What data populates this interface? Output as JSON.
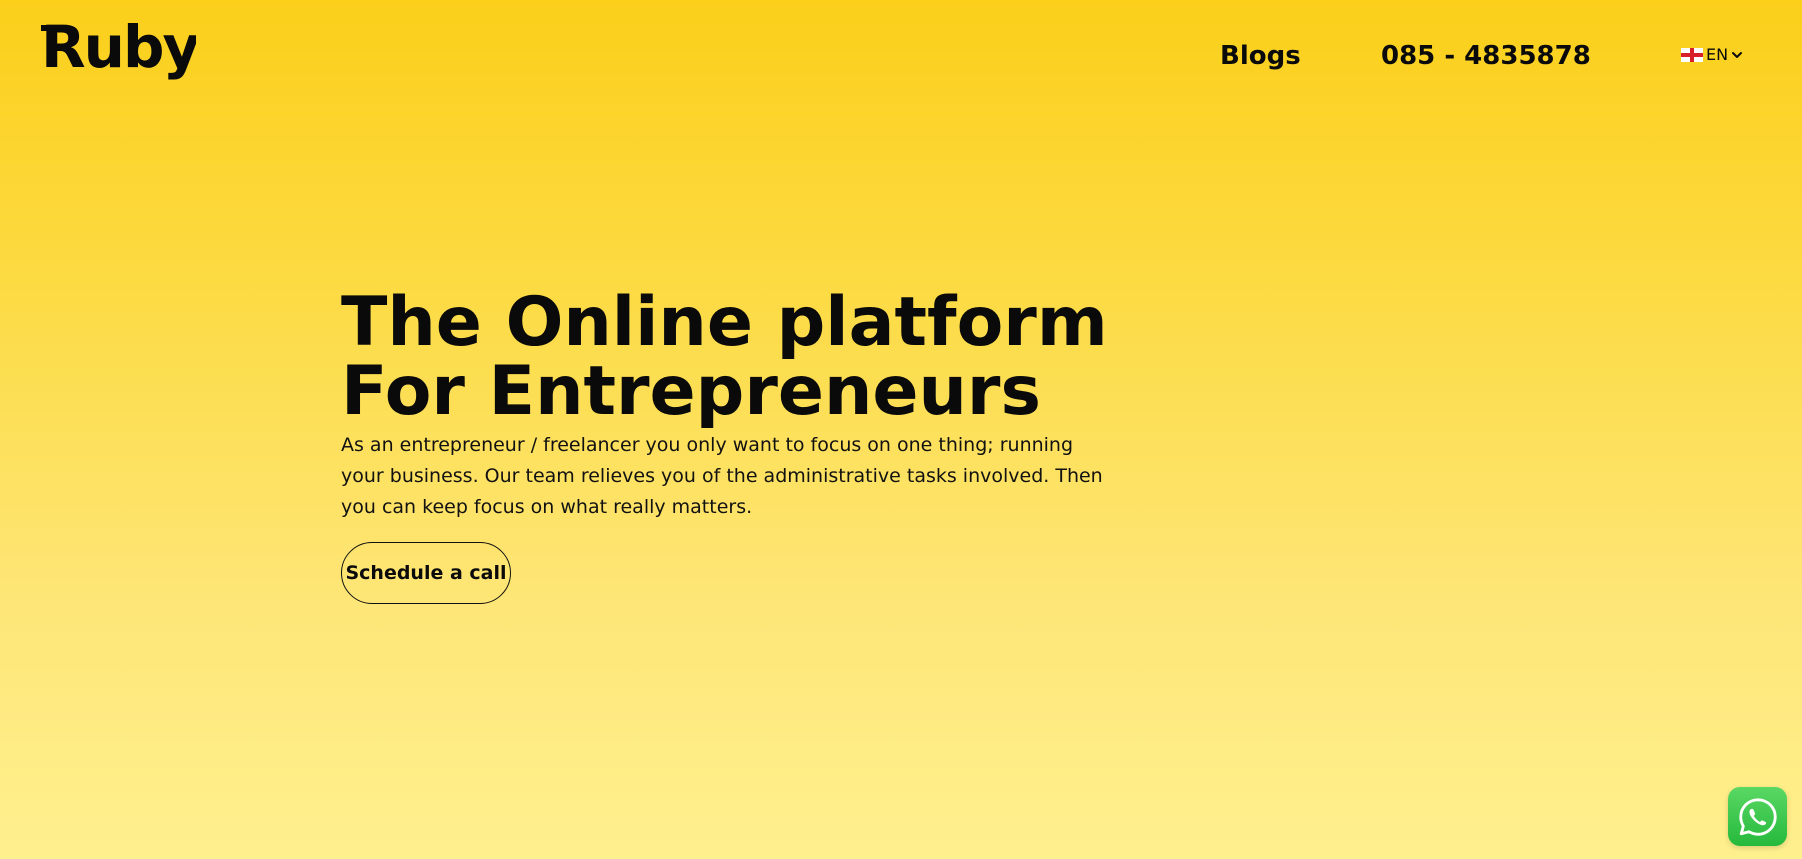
{
  "header": {
    "logo_text": "Ruby",
    "nav": {
      "blogs_label": "Blogs",
      "phone_label": "085 - 4835878"
    },
    "language": {
      "selected": "EN",
      "flag_icon": "england-flag-icon",
      "chevron_icon": "chevron-down-icon"
    }
  },
  "hero": {
    "title_line1": "The Online platform",
    "title_line2": "For Entrepreneurs",
    "description": "As an entrepreneur / freelancer you only want to focus on one thing; running your business. Our team relieves you of the administrative tasks involved. Then you can keep focus on what really matters.",
    "cta_label": "Schedule a call"
  },
  "floating": {
    "whatsapp_icon": "whatsapp-icon"
  },
  "colors": {
    "background_top": "#fbcf1a",
    "background_bottom": "#fff08e",
    "text": "#0a0a0a",
    "whatsapp_green": "#25b93c"
  }
}
